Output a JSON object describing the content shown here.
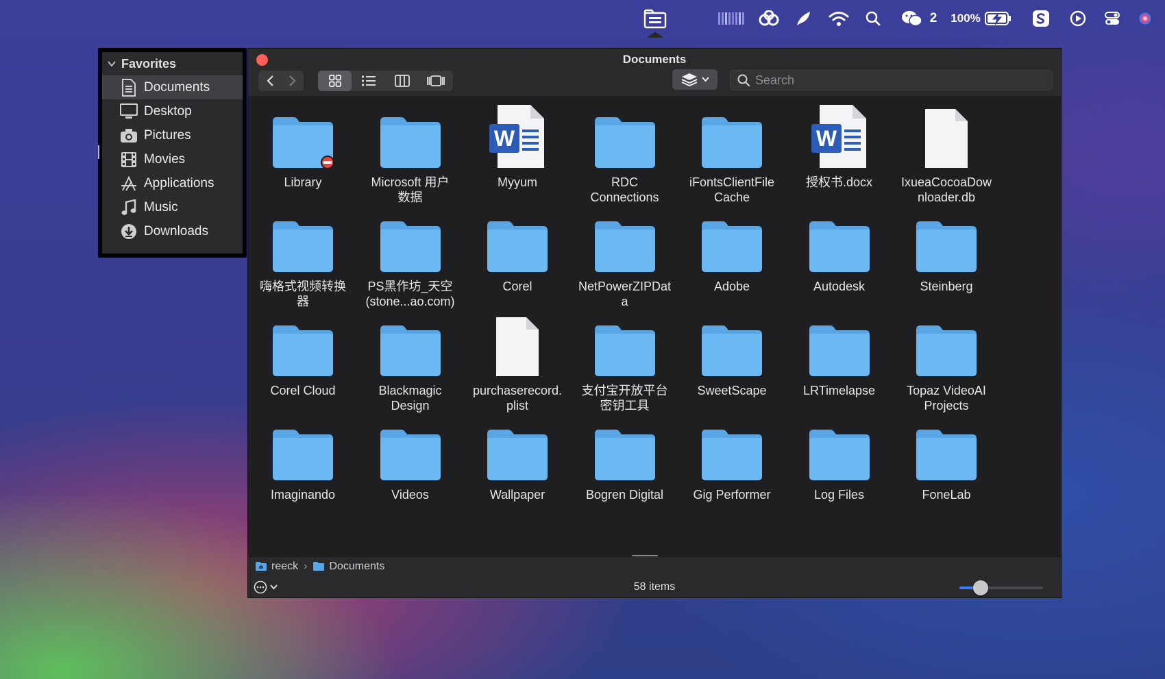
{
  "menubar": {
    "items": [
      {
        "name": "finder-folder-icon"
      },
      {
        "name": "menu-meter-icon"
      },
      {
        "name": "creative-cloud-icon"
      },
      {
        "name": "feather-icon"
      },
      {
        "name": "wifi-icon"
      },
      {
        "name": "spotlight-search-icon"
      },
      {
        "name": "wechat-icon"
      },
      {
        "name": "battery-icon"
      },
      {
        "name": "app-s-icon"
      },
      {
        "name": "play-circle-icon"
      },
      {
        "name": "control-center-icon"
      },
      {
        "name": "siri-icon"
      }
    ],
    "wechat_count": "2",
    "battery_percent": "100%"
  },
  "sidebar": {
    "section_label": "Favorites",
    "items": [
      {
        "label": "Documents",
        "icon": "document-icon",
        "active": true
      },
      {
        "label": "Desktop",
        "icon": "desktop-icon"
      },
      {
        "label": "Pictures",
        "icon": "camera-icon"
      },
      {
        "label": "Movies",
        "icon": "film-icon"
      },
      {
        "label": "Applications",
        "icon": "applications-icon"
      },
      {
        "label": "Music",
        "icon": "music-note-icon"
      },
      {
        "label": "Downloads",
        "icon": "download-icon"
      }
    ]
  },
  "window": {
    "title": "Documents",
    "search_placeholder": "Search",
    "path": [
      "reeck",
      "Documents"
    ],
    "path_separator": "›",
    "status": "58 items",
    "icon_size_slider": 0.25
  },
  "files": [
    {
      "name": "Library",
      "type": "folder",
      "badge": "no-entry"
    },
    {
      "name": "Microsoft 用户\n数据",
      "type": "folder"
    },
    {
      "name": "Myyum",
      "type": "word"
    },
    {
      "name": "RDC\nConnections",
      "type": "folder"
    },
    {
      "name": "iFontsClientFile\nCache",
      "type": "folder"
    },
    {
      "name": "授权书.docx",
      "type": "word"
    },
    {
      "name": "IxueaCocoaDow\nnloader.db",
      "type": "doc"
    },
    {
      "name": "嗨格式视频转换\n器",
      "type": "folder"
    },
    {
      "name": "PS黑作坊_天空\n(stone...ao.com)",
      "type": "folder"
    },
    {
      "name": "Corel",
      "type": "folder"
    },
    {
      "name": "NetPowerZIPDat\na",
      "type": "folder"
    },
    {
      "name": "Adobe",
      "type": "folder"
    },
    {
      "name": "Autodesk",
      "type": "folder"
    },
    {
      "name": "Steinberg",
      "type": "folder"
    },
    {
      "name": "Corel Cloud",
      "type": "folder"
    },
    {
      "name": "Blackmagic\nDesign",
      "type": "folder"
    },
    {
      "name": "purchaserecord.\nplist",
      "type": "doc"
    },
    {
      "name": "支付宝开放平台\n密钥工具",
      "type": "folder"
    },
    {
      "name": "SweetScape",
      "type": "folder"
    },
    {
      "name": "LRTimelapse",
      "type": "folder"
    },
    {
      "name": "Topaz VideoAI\nProjects",
      "type": "folder"
    },
    {
      "name": "Imaginando",
      "type": "folder"
    },
    {
      "name": "Videos",
      "type": "folder"
    },
    {
      "name": "Wallpaper",
      "type": "folder"
    },
    {
      "name": "Bogren Digital",
      "type": "folder"
    },
    {
      "name": "Gig Performer",
      "type": "folder"
    },
    {
      "name": "Log Files",
      "type": "folder"
    },
    {
      "name": "FoneLab",
      "type": "folder"
    }
  ],
  "colors": {
    "folder": "#6cb8f2",
    "folder_tab": "#5aa6e4",
    "close": "#ff5f57",
    "accent": "#3d7bf0",
    "word_blue": "#2b5db8"
  }
}
